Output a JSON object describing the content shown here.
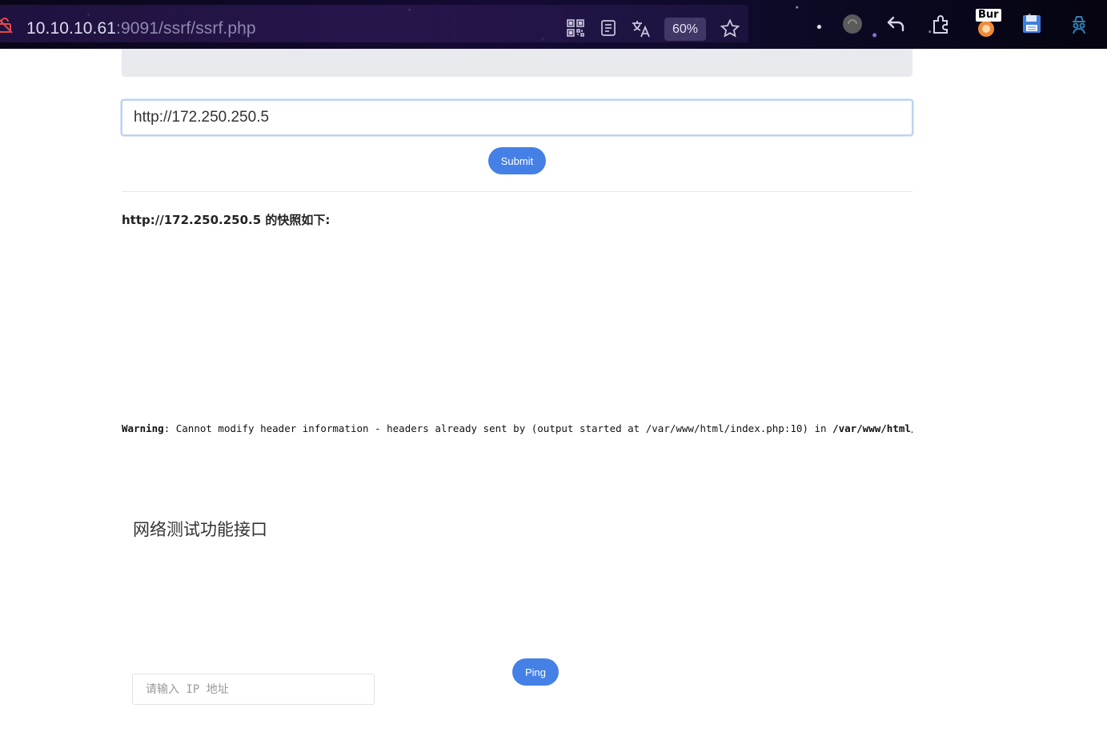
{
  "browser": {
    "url_host": "10.10.10.61",
    "url_path": ":9091/ssrf/ssrf.php",
    "zoom": "60%",
    "extension_badge": "Bur",
    "icons": [
      "not-secure-icon",
      "qr-code-icon",
      "reader-mode-icon",
      "translate-icon",
      "bookmark-star-icon",
      "extension-circle-icon",
      "undo-icon",
      "extensions-puzzle-icon",
      "burp-extension-icon",
      "save-icon",
      "spy-extension-icon"
    ]
  },
  "ssrf": {
    "url_value": "http://172.250.250.5",
    "submit_label": "Submit",
    "snapshot_title": "http://172.250.250.5 的快照如下:"
  },
  "warning": {
    "label": "Warning",
    "message": ":  Cannot modify header information - headers already sent by (output started at /var/www/html/index.php:10) in ",
    "path": "/var/www/html/inc"
  },
  "ping": {
    "title": "网络测试功能接口",
    "placeholder": "请输入 IP 地址",
    "button_label": "Ping"
  },
  "colors": {
    "accent": "#4580e6",
    "panel": "#e9eaee"
  }
}
